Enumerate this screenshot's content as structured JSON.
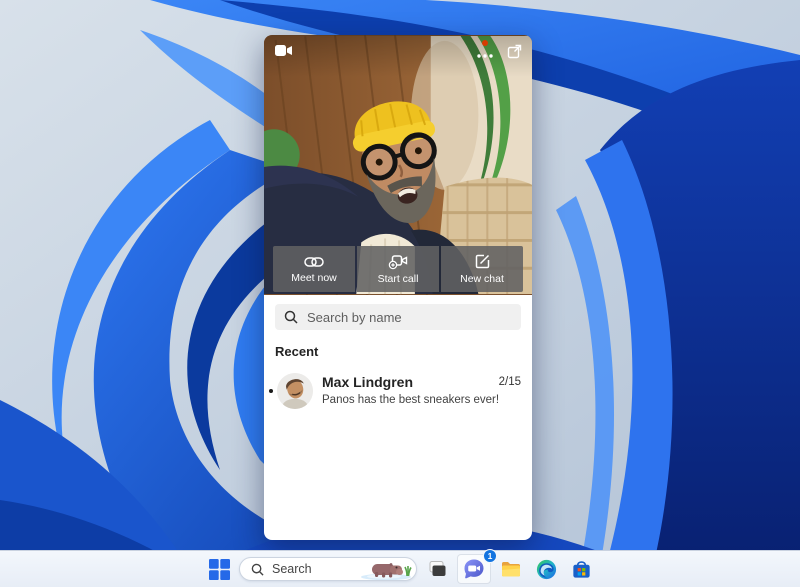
{
  "colors": {
    "accent_blue": "#2a6ef0",
    "bloom_deep_navy": "#081f6e",
    "bloom_bright": "#3b86f6",
    "panel_bg": "#ffffff",
    "overlay_button_bg": "#616162",
    "search_field_bg": "#f0f0f0",
    "taskbar_bg": "#eef3fa",
    "badge_blue": "#1374e0",
    "notification_red": "#d83b01",
    "beanie_yellow": "#eec11f"
  },
  "chat_panel": {
    "video_header": {
      "camera_icon": "video-camera",
      "more_icon": "ellipsis",
      "expand_icon": "open-window",
      "has_notification_dot": true
    },
    "actions": [
      {
        "label": "Meet now",
        "icon": "link"
      },
      {
        "label": "Start call",
        "icon": "video-call-plus"
      },
      {
        "label": "New chat",
        "icon": "compose"
      }
    ],
    "search": {
      "placeholder": "Search by name",
      "icon": "magnifier"
    },
    "recent_label": "Recent",
    "conversations": [
      {
        "name": "Max Lindgren",
        "message": "Panos has the best sneakers ever!",
        "date": "2/15",
        "unread": true
      }
    ]
  },
  "taskbar": {
    "start_icon": "windows-logo",
    "search": {
      "label": "Search",
      "icon": "magnifier",
      "image": "hippo-daily-image"
    },
    "icons": [
      {
        "name": "task-view"
      },
      {
        "name": "chat-teams",
        "badge": "1",
        "active": true
      },
      {
        "name": "file-explorer"
      },
      {
        "name": "edge-browser"
      },
      {
        "name": "microsoft-store"
      }
    ]
  }
}
